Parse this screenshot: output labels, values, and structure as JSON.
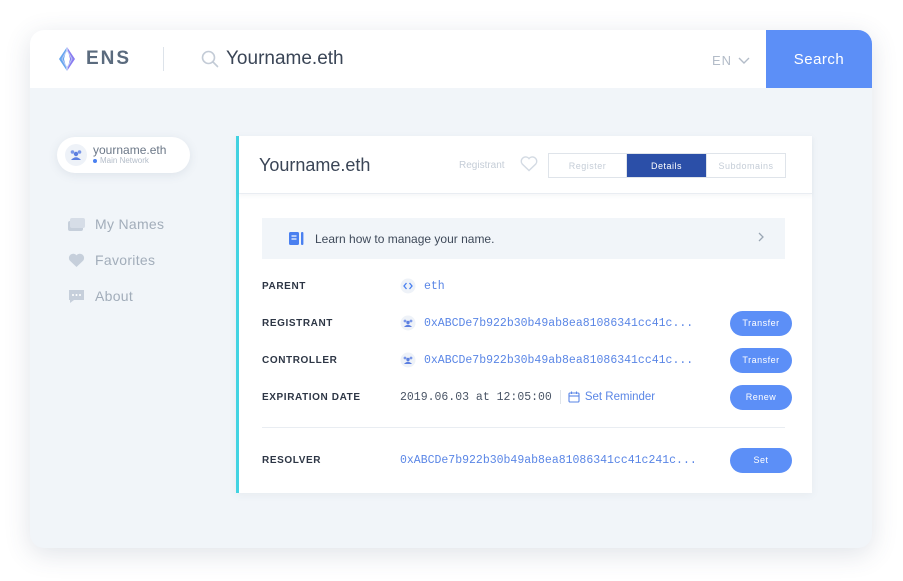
{
  "header": {
    "logo_text": "ENS",
    "search_value": "Yourname.eth",
    "language": "EN",
    "search_button": "Search"
  },
  "account": {
    "name": "yourname.eth",
    "network": "Main Network"
  },
  "sidebar": {
    "items": [
      {
        "label": "My Names",
        "icon": "wallet-icon"
      },
      {
        "label": "Favorites",
        "icon": "heart-icon"
      },
      {
        "label": "About",
        "icon": "chat-icon"
      }
    ]
  },
  "panel": {
    "title": "Yourname.eth",
    "registrant_label": "Registrant",
    "tabs": [
      {
        "label": "Register",
        "active": false
      },
      {
        "label": "Details",
        "active": true
      },
      {
        "label": "Subdomains",
        "active": false
      }
    ],
    "info_text": "Learn how to manage your name.",
    "parent": {
      "label": "PARENT",
      "value": "eth"
    },
    "registrant": {
      "label": "REGISTRANT",
      "value": "0xABCDe7b922b30b49ab8ea81086341cc41c...",
      "action": "Transfer"
    },
    "controller": {
      "label": "CONTROLLER",
      "value": "0xABCDe7b922b30b49ab8ea81086341cc41c...",
      "action": "Transfer"
    },
    "expiration": {
      "label": "EXPIRATION DATE",
      "value": "2019.06.03 at 12:05:00",
      "reminder": "Set Reminder",
      "action": "Renew"
    },
    "resolver": {
      "label": "RESOLVER",
      "value": "0xABCDe7b922b30b49ab8ea81086341cc41c241c...",
      "action": "Set"
    }
  },
  "colors": {
    "accent": "#5c8ff7",
    "active_tab": "#2b4fa8",
    "panel_border": "#42d3e2",
    "link": "#5a86e6"
  }
}
